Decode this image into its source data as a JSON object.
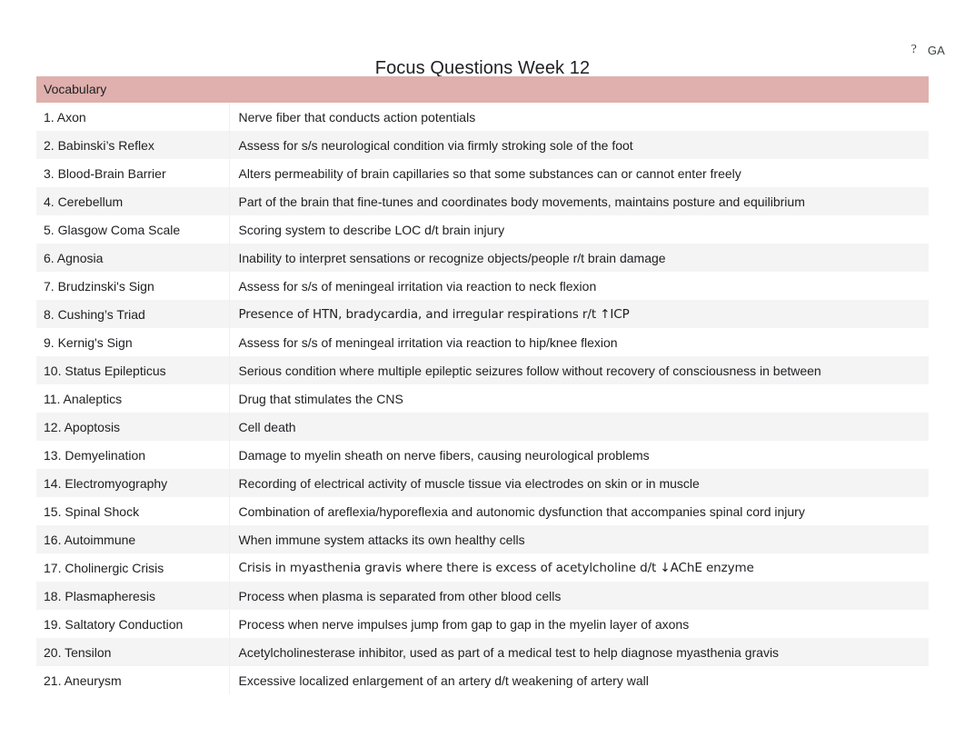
{
  "top_bar": {
    "help_icon": "?",
    "account_initials": "GA"
  },
  "document": {
    "title": "Focus Questions Week 12"
  },
  "table": {
    "header": {
      "term_column": "Vocabulary",
      "definition_column": ""
    },
    "header_color": "#dfb0ad",
    "rows": [
      {
        "term": "1. Axon",
        "definition": "Nerve fiber that conducts action potentials",
        "alt_font": false
      },
      {
        "term": "2. Babinski’s Reflex",
        "definition": "Assess for s/s neurological condition via firmly stroking sole of the foot",
        "alt_font": false
      },
      {
        "term": "3. Blood-Brain Barrier",
        "definition": "Alters permeability of brain capillaries so that some substances can or cannot enter freely",
        "alt_font": false
      },
      {
        "term": "4. Cerebellum",
        "definition": "Part of the brain that fine-tunes and coordinates body movements, maintains posture and equilibrium",
        "alt_font": false
      },
      {
        "term": "5. Glasgow Coma Scale",
        "definition": "Scoring system to describe LOC d/t brain injury",
        "alt_font": false
      },
      {
        "term": "6. Agnosia",
        "definition": "Inability to interpret sensations or recognize objects/people r/t brain damage",
        "alt_font": false
      },
      {
        "term": "7. Brudzinski's Sign",
        "definition": "Assess for s/s of meningeal irritation via reaction to neck flexion",
        "alt_font": false
      },
      {
        "term": "8. Cushing’s Triad",
        "definition": "Presence of HTN, bradycardia, and irregular respirations r/t ↑ICP",
        "alt_font": true
      },
      {
        "term": "9. Kernig's Sign",
        "definition": "Assess for s/s of meningeal irritation via reaction to hip/knee flexion",
        "alt_font": false
      },
      {
        "term": "10. Status Epilepticus",
        "definition": "Serious condition where multiple epileptic seizures follow without recovery of consciousness in between",
        "alt_font": false
      },
      {
        "term": "11. Analeptics",
        "definition": "Drug that stimulates the CNS",
        "alt_font": false
      },
      {
        "term": "12. Apoptosis",
        "definition": "Cell death",
        "alt_font": false
      },
      {
        "term": "13. Demyelination",
        "definition": "Damage to myelin sheath on nerve fibers, causing neurological problems",
        "alt_font": false
      },
      {
        "term": "14. Electromyography",
        "definition": "Recording of electrical activity of muscle tissue via electrodes on skin or in muscle",
        "alt_font": false
      },
      {
        "term": "15. Spinal Shock",
        "definition": "Combination of areflexia/hyporeflexia and autonomic dysfunction that accompanies spinal cord injury",
        "alt_font": false
      },
      {
        "term": "16. Autoimmune",
        "definition": "When immune system attacks its own healthy cells",
        "alt_font": false
      },
      {
        "term": "17. Cholinergic Crisis",
        "definition": "Crisis in myasthenia gravis where there is excess of acetylcholine d/t ↓AChE enzyme",
        "alt_font": true
      },
      {
        "term": "18. Plasmapheresis",
        "definition": "Process when plasma is separated from other blood cells",
        "alt_font": false
      },
      {
        "term": "19. Saltatory Conduction",
        "definition": "Process when nerve impulses jump from gap to gap in the myelin layer of axons",
        "alt_font": false
      },
      {
        "term": "20. Tensilon",
        "definition": "Acetylcholinesterase inhibitor, used as part of a medical test to help diagnose myasthenia gravis",
        "alt_font": false
      },
      {
        "term": "21. Aneurysm",
        "definition": "Excessive localized enlargement of an artery d/t weakening of artery wall",
        "alt_font": false
      }
    ]
  }
}
